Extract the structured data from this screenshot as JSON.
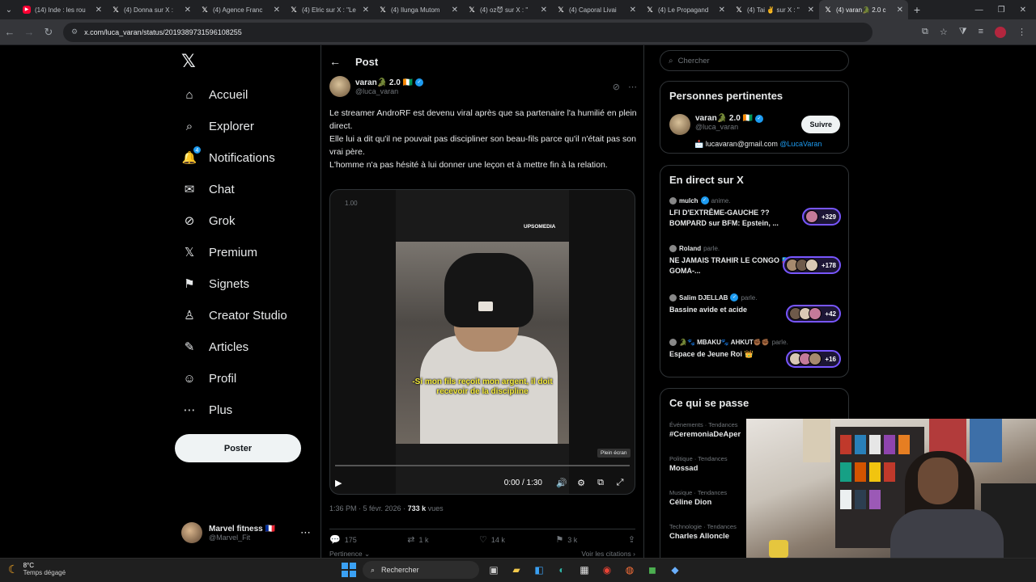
{
  "browser": {
    "tabs": [
      {
        "label": "(14) Inde : les rou",
        "favicon": "YT"
      },
      {
        "label": "(4) Donna sur X :",
        "favicon": "X"
      },
      {
        "label": "(4) Agence Franc",
        "favicon": "X"
      },
      {
        "label": "(4) Elric sur X : \"Le",
        "favicon": "X"
      },
      {
        "label": "(4) Ilunga Mutom",
        "favicon": "X"
      },
      {
        "label": "(4) oz😈 sur X : \"",
        "favicon": "X"
      },
      {
        "label": "(4) Caporal Livai",
        "favicon": "X"
      },
      {
        "label": "(4) Le Propagand",
        "favicon": "X"
      },
      {
        "label": "(4) Tai ✌️ sur X : \"",
        "favicon": "X"
      },
      {
        "label": "(4) varan🐊 2.0 c",
        "favicon": "X",
        "active": true
      }
    ],
    "url": "x.com/luca_varan/status/2019389731596108255"
  },
  "nav": {
    "logo": "𝕏",
    "items": [
      {
        "label": "Accueil",
        "icon": "home-icon",
        "glyph": "⌂"
      },
      {
        "label": "Explorer",
        "icon": "search-icon",
        "glyph": "⌕"
      },
      {
        "label": "Notifications",
        "icon": "bell-icon",
        "glyph": "🔔",
        "badge": "4"
      },
      {
        "label": "Chat",
        "icon": "mail-icon",
        "glyph": "✉"
      },
      {
        "label": "Grok",
        "icon": "grok-icon",
        "glyph": "⊘"
      },
      {
        "label": "Premium",
        "icon": "x-premium-icon",
        "glyph": "𝕏"
      },
      {
        "label": "Signets",
        "icon": "bookmark-icon",
        "glyph": "⚑"
      },
      {
        "label": "Creator Studio",
        "icon": "creator-studio-icon",
        "glyph": "♙"
      },
      {
        "label": "Articles",
        "icon": "articles-icon",
        "glyph": "✎"
      },
      {
        "label": "Profil",
        "icon": "profile-icon",
        "glyph": "☺"
      },
      {
        "label": "Plus",
        "icon": "more-circle-icon",
        "glyph": "⋯"
      }
    ],
    "post_button": "Poster",
    "account": {
      "name": "Marvel fitness 🇫🇷",
      "handle": "@Marvel_Fit"
    }
  },
  "post": {
    "header_title": "Post",
    "author_name": "varan🐊 2.0 🇨🇮",
    "author_handle": "@luca_varan",
    "text_lines": [
      "Le streamer AndroRF est devenu viral après que sa partenaire l'a humilié en plein direct.",
      "Elle lui a dit qu'il ne pouvait pas discipliner son beau-fils parce qu'il n'était pas son vrai père.",
      "L'homme n'a pas hésité à lui donner une leçon et à mettre fin à la relation."
    ],
    "video": {
      "top_left_label": "1.00",
      "watermark": "UPSOMEDIA",
      "subtitle": "-Si mon fils reçoit mon argent, il doit recevoir de la discipline",
      "tooltip": "Plein écran",
      "time": "0:00 / 1:30",
      "progress": 0
    },
    "timestamp": "1:36 PM · 5 févr. 2026 · ",
    "views_count": "733 k",
    "views_label": " vues",
    "replies": "175",
    "reposts": "1 k",
    "likes": "14 k",
    "bookmarks": "3 k",
    "relevance": "Pertinence ⌄",
    "quotes": "Voir les citations ›"
  },
  "sidebar": {
    "search_placeholder": "Chercher",
    "relevant_title": "Personnes pertinentes",
    "relevant_user": {
      "name": "varan🐊 2.0 🇨🇮",
      "handle": "@luca_varan",
      "follow": "Suivre",
      "bio": "📩 lucavaran@gmail.com ",
      "bio_link": "@LucaVaran"
    },
    "live_title": "En direct sur X",
    "live": [
      {
        "host": "mulch",
        "verified": true,
        "action": "anime.",
        "title": "LFI D'EXTRÊME-GAUCHE ?? BOMPARD sur BFM: Epstein, ...",
        "count": "+329",
        "avatars": 1
      },
      {
        "host": "Roland",
        "verified": false,
        "action": "parle.",
        "title": "NE JAMAIS TRAHIR LE CONGO 🇨🇩 GOMA-...",
        "count": "+178",
        "avatars": 3
      },
      {
        "host": "Salim DJELLAB",
        "verified": true,
        "action": "parle.",
        "title": "Bassine avide et acide",
        "count": "+42",
        "avatars": 3
      },
      {
        "host": "🐊🐾 MBAKU🐾 AHKUT✊🏾✊🏾",
        "verified": false,
        "action": "parle.",
        "title": "Espace de Jeune Roi 👑",
        "count": "+16",
        "avatars": 3
      }
    ],
    "trends_title": "Ce qui se passe",
    "trends": [
      {
        "category": "Événements · Tendances",
        "name": "#CeremoniaDeAper"
      },
      {
        "category": "Politique · Tendances",
        "name": "Mossad"
      },
      {
        "category": "Musique · Tendances",
        "name": "Céline Dion"
      },
      {
        "category": "Technologie · Tendances",
        "name": "Charles Alloncle"
      }
    ]
  },
  "taskbar": {
    "temperature": "8°C",
    "weather": "Temps dégagé",
    "search": "Rechercher"
  },
  "colors": {
    "accent": "#1d9bf0",
    "background": "#000000",
    "border": "#2f3336",
    "live_pill": "#7856ff",
    "subtitle": "#f6ec3b"
  }
}
